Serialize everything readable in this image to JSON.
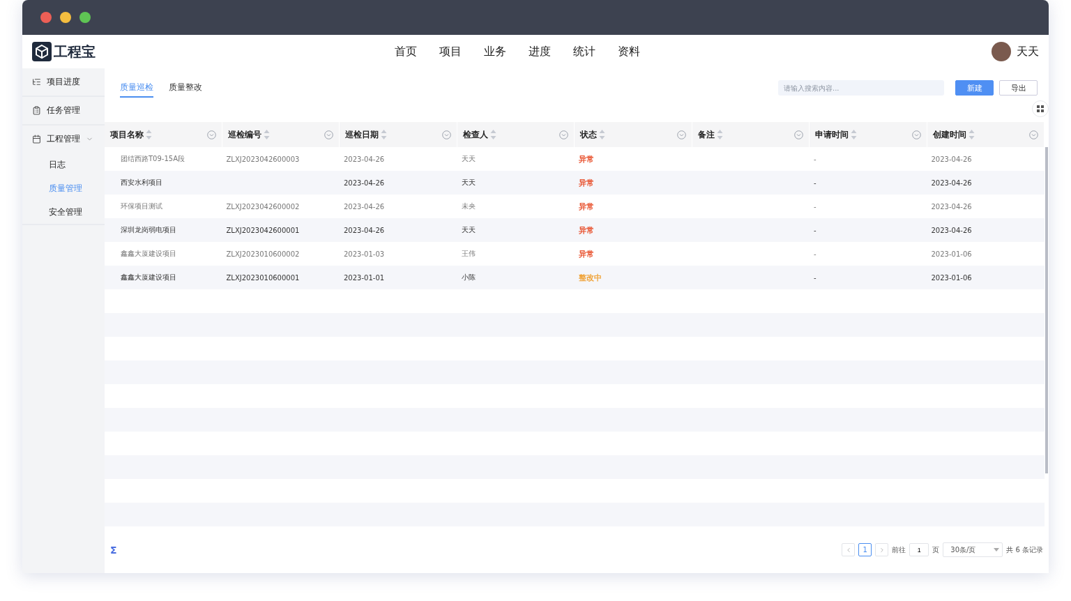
{
  "brand": {
    "name": "工程宝"
  },
  "nav": [
    {
      "label": "首页",
      "selected": false
    },
    {
      "label": "项目",
      "selected": false
    },
    {
      "label": "业务",
      "selected": false
    },
    {
      "label": "进度",
      "selected": false
    },
    {
      "label": "统计",
      "selected": false
    },
    {
      "label": "资料",
      "selected": false
    }
  ],
  "user": {
    "name": "天天"
  },
  "sidebar": {
    "items": [
      {
        "label": "项目进度",
        "selected": false
      },
      {
        "label": "任务管理",
        "selected": false
      },
      {
        "label": "工程管理",
        "selected": false,
        "expanded": true,
        "children": [
          {
            "label": "日志",
            "selected": false
          },
          {
            "label": "质量管理",
            "selected": true
          },
          {
            "label": "安全管理",
            "selected": false
          }
        ]
      }
    ]
  },
  "tabs": [
    {
      "label": "质量巡检",
      "selected": true
    },
    {
      "label": "质量整改",
      "selected": false
    }
  ],
  "search": {
    "placeholder": "请输入搜索内容..."
  },
  "buttons": [
    {
      "label": "新建",
      "kind": "primary"
    },
    {
      "label": "导出",
      "kind": "plain"
    }
  ],
  "table": {
    "columns": [
      "项目名称",
      "巡检编号",
      "巡检日期",
      "检查人",
      "状态",
      "备注",
      "申请时间",
      "创建时间"
    ],
    "rows": [
      {
        "name": "团结西路T09-15A段",
        "code": "ZLXJ2023042600003",
        "date": "2023-04-26",
        "inspector": "天天",
        "status": {
          "text": "异常",
          "color": "#e8502c"
        },
        "apply_time": "-",
        "created": "2023-04-26"
      },
      {
        "name": "西安水利项目",
        "date": "2023-04-26",
        "inspector": "天天",
        "status": {
          "text": "异常",
          "color": "#e8502c"
        },
        "apply_time": "-",
        "created": "2023-04-26"
      },
      {
        "name": "环保项目测试",
        "code": "ZLXJ2023042600002",
        "date": "2023-04-26",
        "inspector": "未央",
        "status": {
          "text": "异常",
          "color": "#e8502c"
        },
        "apply_time": "-",
        "created": "2023-04-26"
      },
      {
        "name": "深圳龙岗弱电项目",
        "code": "ZLXJ2023042600001",
        "date": "2023-04-26",
        "inspector": "天天",
        "status": {
          "text": "异常",
          "color": "#e8502c"
        },
        "apply_time": "-",
        "created": "2023-04-26"
      },
      {
        "name": "鑫鑫大厦建设项目",
        "code": "ZLXJ2023010600002",
        "date": "2023-01-03",
        "inspector": "王伟",
        "status": {
          "text": "异常",
          "color": "#e8502c"
        },
        "apply_time": "-",
        "created": "2023-01-06"
      },
      {
        "name": "鑫鑫大厦建设项目",
        "code": "ZLXJ2023010600001",
        "date": "2023-01-01",
        "inspector": "小陈",
        "status": {
          "text": "整改中",
          "color": "#f0a43a"
        },
        "apply_time": "-",
        "created": "2023-01-06"
      }
    ]
  },
  "footer": {
    "sum_sign": "Σ"
  },
  "pagination": {
    "pages": [
      {
        "label": "1",
        "selected": true
      }
    ],
    "goto_label": "前往",
    "goto_value": "1",
    "page_unit": "页",
    "page_size": "30条/页",
    "total": "共 6 条记录"
  }
}
